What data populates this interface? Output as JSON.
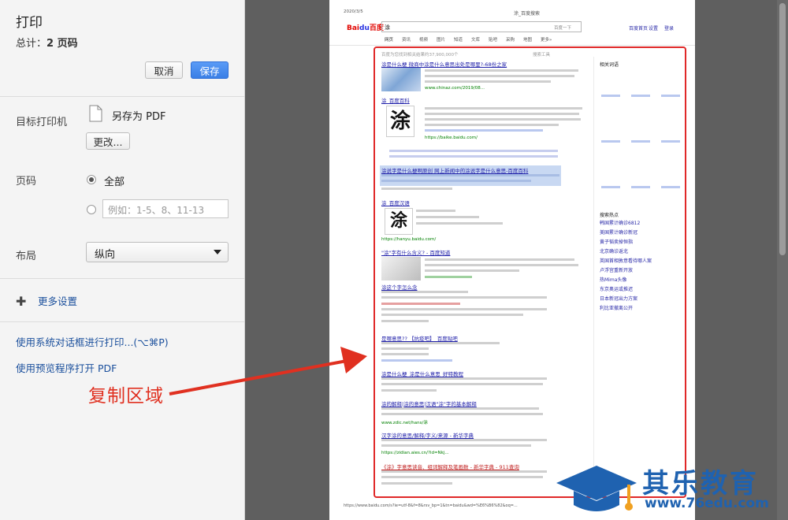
{
  "dialog": {
    "title": "打印",
    "total_label": "总计：",
    "total_value": "2 页码",
    "cancel_label": "取消",
    "save_label": "保存",
    "destination_label": "目标打印机",
    "destination_value": "另存为 PDF",
    "change_label": "更改...",
    "pages_label": "页码",
    "pages_all": "全部",
    "pages_custom_placeholder": "例如：1-5、8、11-13",
    "layout_label": "布局",
    "layout_value": "纵向",
    "more_settings": "更多设置",
    "system_dialog_link": "使用系统对话框进行打印...(⌥⌘P)",
    "preview_app_link": "使用预览程序打开 PDF"
  },
  "preview": {
    "date": "2020/3/5",
    "page_title": "涂_百度搜索",
    "search_query": "涂",
    "search_button": "百度一下",
    "tabs": [
      "网页",
      "资讯",
      "视频",
      "图片",
      "知道",
      "文库",
      "贴吧",
      "采购",
      "地图",
      "更多»"
    ],
    "result_count": "百度为您找到相关结果约37,900,000个",
    "search_tools": "搜索工具",
    "results": [
      {
        "title": "涂是什么梗 微商中涂是什么意思出处是哪里?-68份之家",
        "url": "www.chinaz.com/2019/08..."
      },
      {
        "title": "涂_百度百科",
        "url": "https://baike.baidu.com/"
      },
      {
        "title": "涂说字是什么梗啊原创 网上新闻中的涂说字是什么意思-百度百科",
        "url": ""
      },
      {
        "title": "涂_百度汉语",
        "url": "https://hanyu.baidu.com/"
      },
      {
        "title": "\"涂\"字有什么含义? - 百度知道",
        "url": ""
      },
      {
        "title": "涂这个字怎么念",
        "url": ""
      },
      {
        "title": "是哪意思?? 【抗疫吧】_百度贴吧",
        "url": ""
      },
      {
        "title": "涂是什么梗_涂是什么意思_好特教程",
        "url": ""
      },
      {
        "title": "涂的解释|涂的意思|汉语\"涂\"字的基本解释",
        "url": "www.zdic.net/hans/涂"
      },
      {
        "title": "汉字涂的意思/解释/字义/来源 - 新华字典",
        "url": "https://zidian.aies.cn/?id=Nkj..."
      },
      {
        "title": "《涂》字意思读音、组词解释及笔画数 - 新华字典 - 911查询",
        "url": ""
      }
    ],
    "related_title": "相关词语",
    "hot_title": "搜索热点",
    "hot_items": [
      "韩国累计确诊6812",
      "美国累计确诊新冠",
      "黄子韬卖掉恒指",
      "北京确诊返北",
      "英国首相敦意看待哪人案",
      "卢浮宫重新开放",
      "热Mima头像",
      "东京奥运或推迟",
      "日本新冠出力方案",
      "利比亚撤离公开"
    ],
    "footer_url": "https://www.baidu.com/s?ie=utf-8&f=8&rsv_bp=1&tn=baidu&wd=%E6%B6%82&oq=..."
  },
  "annotation": {
    "label": "复制区域",
    "color": "#e03020"
  },
  "watermark": {
    "brand": "其乐教育",
    "url": "www.76edu.com",
    "color": "#1f62b0"
  }
}
